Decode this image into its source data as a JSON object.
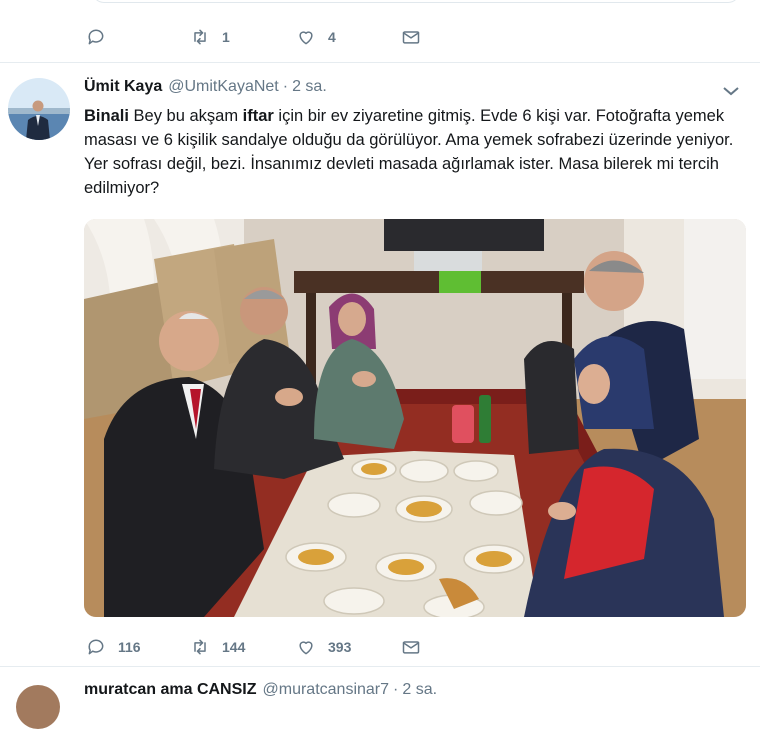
{
  "prev_tweet": {
    "actions": {
      "reply_count": "",
      "retweet_count": "1",
      "like_count": "4"
    }
  },
  "tweet": {
    "author_name": "Ümit Kaya",
    "author_handle": "@UmitKayaNet",
    "separator": "·",
    "time": "2 sa.",
    "text_parts": {
      "p1": "Binali",
      "p2": " Bey bu akşam ",
      "p3": "iftar",
      "p4": " için bir ev ziyaretine gitmiş. Evde 6 kişi var. Fotoğrafta yemek masası ve 6 kişilik sandalye olduğu da görülüyor. Ama yemek sofrabezi üzerinde yeniyor. Yer sofrası değil, bezi. İnsanımız devleti masada ağırlamak ister. Masa bilerek mi tercih edilmiyor?"
    },
    "actions": {
      "reply_count": "116",
      "retweet_count": "144",
      "like_count": "393"
    }
  },
  "next_tweet": {
    "author_name": "muratcan ama CANSIZ",
    "author_handle": "@muratcansinar7",
    "time": "2 sa."
  },
  "icons": [
    "reply-icon",
    "retweet-icon",
    "like-icon",
    "dm-icon",
    "chevron-down-icon"
  ],
  "colors": {
    "icon_gray": "#657786",
    "text": "#14171a",
    "divider": "#e6ecf0"
  }
}
